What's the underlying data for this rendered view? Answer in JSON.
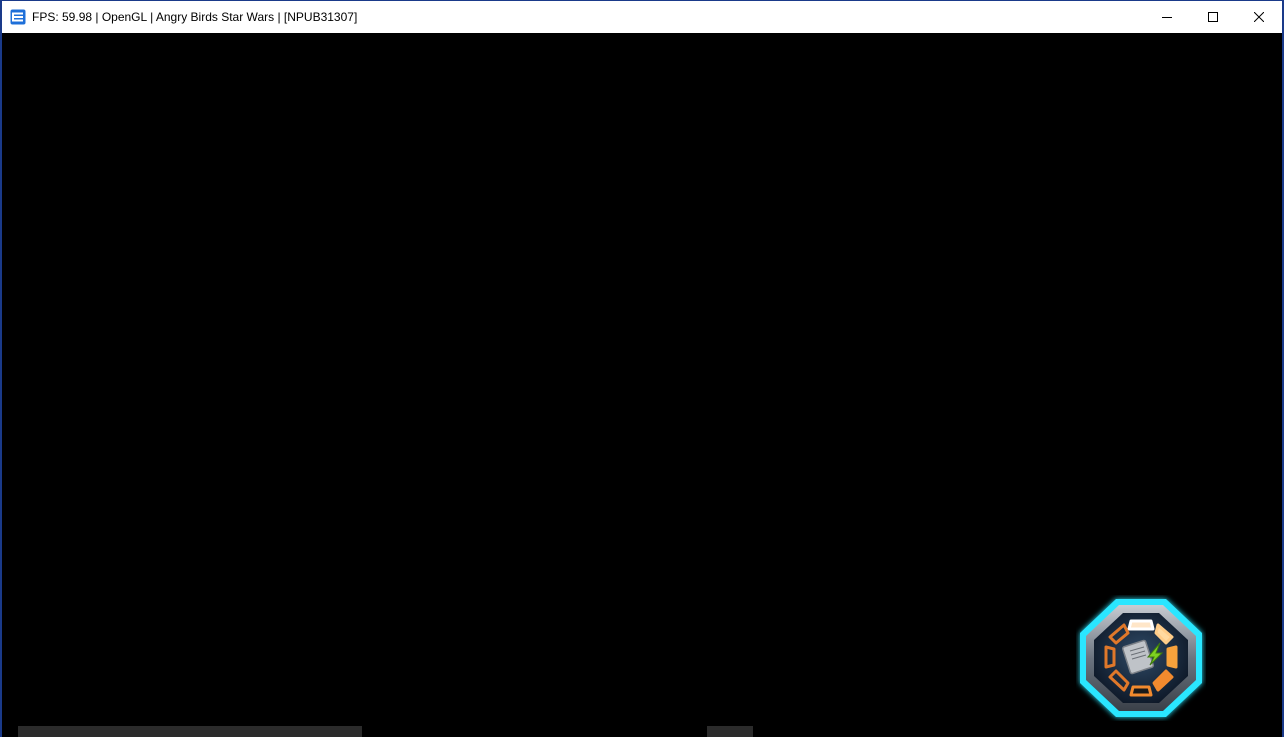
{
  "window": {
    "title": "FPS: 59.98 | OpenGL | Angry Birds Star Wars | [NPUB31307]",
    "app_icon": "rpcs3-icon",
    "controls": {
      "minimize_icon": "minimize-icon",
      "maximize_icon": "maximize-icon",
      "close_icon": "close-icon"
    }
  },
  "game": {
    "background": "#000000",
    "hud_button": {
      "icon": "save-disc-octagon-icon",
      "glow_color": "#29e6ff",
      "accent_color": "#f28a2e"
    }
  },
  "colors": {
    "titlebar_bg": "#ffffff",
    "window_border": "#1a3a8a",
    "title_text": "#000000"
  }
}
